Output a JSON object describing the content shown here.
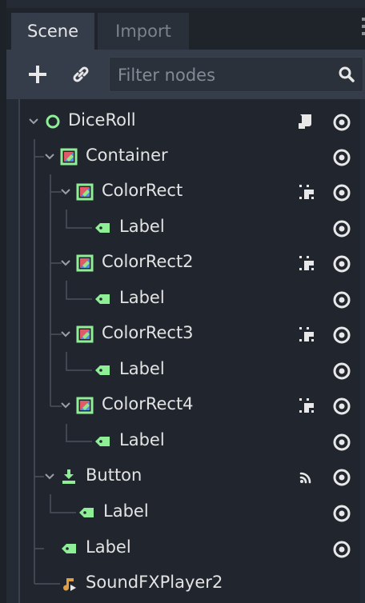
{
  "tabs": [
    {
      "label": "Scene",
      "active": true
    },
    {
      "label": "Import",
      "active": false
    }
  ],
  "toolbar": {
    "add_icon": "plus-icon",
    "link_icon": "link-icon",
    "filter_placeholder": "Filter nodes",
    "search_icon": "search-icon"
  },
  "tree": {
    "nodes": [
      {
        "label": "DiceRoll",
        "icon": "node2d-circle-icon",
        "badge": "script-icon",
        "visible": true
      },
      {
        "label": "Container",
        "icon": "colorrect-icon",
        "visible": true
      },
      {
        "label": "ColorRect",
        "icon": "colorrect-icon",
        "badge": "group-icon",
        "visible": true
      },
      {
        "label": "Label",
        "icon": "label-icon",
        "visible": true
      },
      {
        "label": "ColorRect2",
        "icon": "colorrect-icon",
        "badge": "group-icon",
        "visible": true
      },
      {
        "label": "Label",
        "icon": "label-icon",
        "visible": true
      },
      {
        "label": "ColorRect3",
        "icon": "colorrect-icon",
        "badge": "group-icon",
        "visible": true
      },
      {
        "label": "Label",
        "icon": "label-icon",
        "visible": true
      },
      {
        "label": "ColorRect4",
        "icon": "colorrect-icon",
        "badge": "group-icon",
        "visible": true
      },
      {
        "label": "Label",
        "icon": "label-icon",
        "visible": true
      },
      {
        "label": "Button",
        "icon": "button-icon",
        "badge": "signal-icon",
        "visible": true
      },
      {
        "label": "Label",
        "icon": "label-icon",
        "visible": true
      },
      {
        "label": "Label",
        "icon": "label-icon",
        "visible": true
      },
      {
        "label": "SoundFXPlayer2",
        "icon": "audio-player-icon"
      }
    ]
  },
  "colors": {
    "accent_green": "#8eef97",
    "audio_orange": "#e0a040",
    "panel_bg": "#252b34",
    "tree_bg": "#21262e"
  }
}
